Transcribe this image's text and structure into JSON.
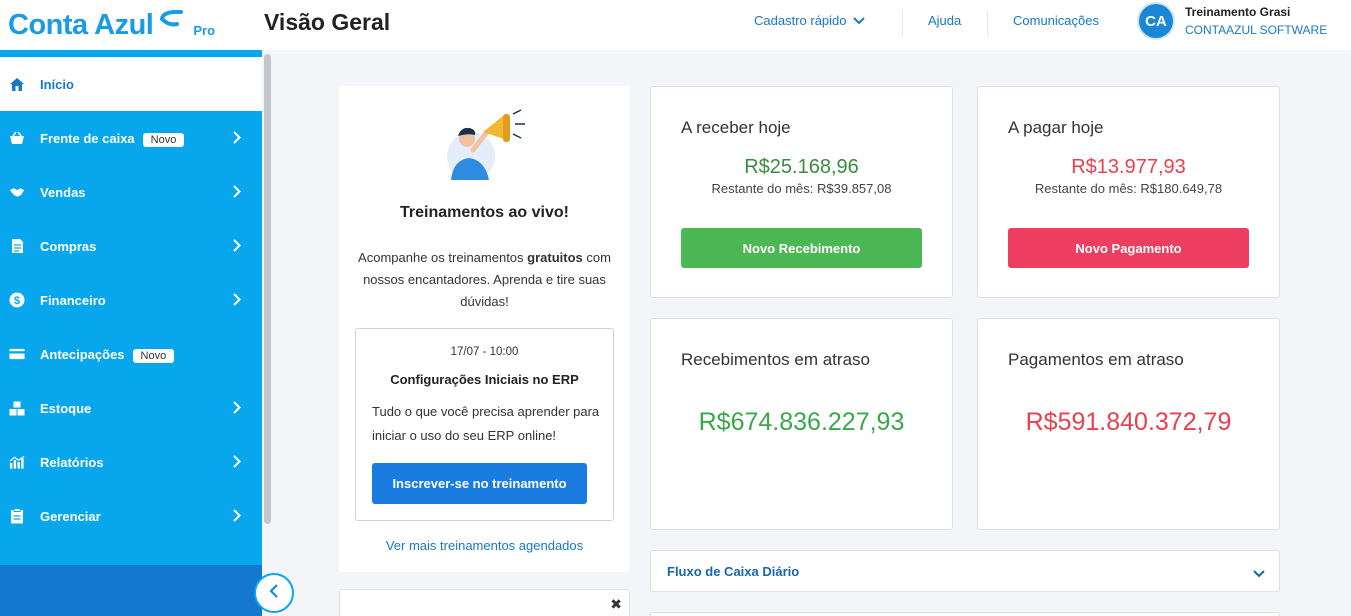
{
  "brand": {
    "name": "Conta Azul",
    "tier": "Pro",
    "color": "#1a9be6"
  },
  "page_title": "Visão Geral",
  "header_nav": {
    "quick_register": "Cadastro rápido",
    "help": "Ajuda",
    "communications": "Comunicações"
  },
  "user": {
    "initials": "CA",
    "name": "Treinamento Grasi",
    "company": "CONTAAZUL SOFTWARE"
  },
  "sidebar": {
    "items": [
      {
        "label": "Início",
        "icon": "home-icon",
        "active": true
      },
      {
        "label": "Frente de caixa",
        "icon": "basket-icon",
        "badge": "Novo"
      },
      {
        "label": "Vendas",
        "icon": "handshake-icon"
      },
      {
        "label": "Compras",
        "icon": "document-icon"
      },
      {
        "label": "Financeiro",
        "icon": "dollar-icon"
      },
      {
        "label": "Antecipações",
        "icon": "card-icon",
        "badge": "Novo"
      },
      {
        "label": "Estoque",
        "icon": "boxes-icon"
      },
      {
        "label": "Relatórios",
        "icon": "chart-icon"
      },
      {
        "label": "Gerenciar",
        "icon": "clipboard-icon"
      }
    ]
  },
  "training": {
    "title": "Treinamentos ao vivo!",
    "desc_before": "Acompanhe os treinamentos ",
    "desc_bold": "gratuitos",
    "desc_after": " com nossos encantadores. Aprenda e tire suas dúvidas!",
    "event": {
      "date": "17/07 - 10:00",
      "title": "Configurações Iniciais no ERP",
      "desc": "Tudo o que você precisa aprender para iniciar o uso do seu ERP online!",
      "button": "Inscrever-se no treinamento"
    },
    "more_link": "Ver mais treinamentos agendados"
  },
  "receive_today": {
    "title": "A receber hoje",
    "amount": "R$25.168,96",
    "rest": "Restante do mês: R$39.857,08",
    "button": "Novo Recebimento"
  },
  "pay_today": {
    "title": "A pagar hoje",
    "amount": "R$13.977,93",
    "rest": "Restante do mês: R$180.649,78",
    "button": "Novo Pagamento"
  },
  "late_receipts": {
    "title": "Recebimentos em atraso",
    "amount": "R$674.836.227,93"
  },
  "late_payments": {
    "title": "Pagamentos em atraso",
    "amount": "R$591.840.372,79"
  },
  "cashflow": {
    "label": "Fluxo de Caixa Diário"
  },
  "colors": {
    "sidebar": "#08a6ec",
    "positive": "#3aa84a",
    "negative": "#e9404f",
    "receive_button": "#4cb854",
    "pay_button": "#ee3e5f",
    "primary_button": "#1a7ce0"
  }
}
